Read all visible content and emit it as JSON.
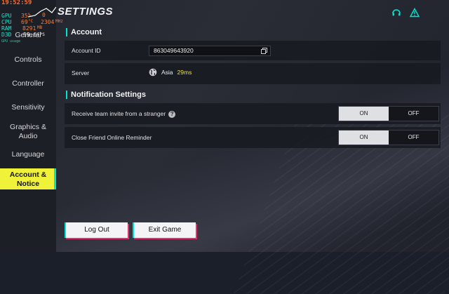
{
  "overlay": {
    "clock": "19:52:59",
    "rows": [
      {
        "label": "GPU",
        "value": "35",
        "unit": "%"
      },
      {
        "label": "CPU",
        "value": "69",
        "unit": "°C"
      },
      {
        "label": "RAM",
        "value": "8291",
        "unit": "MB"
      },
      {
        "label": "D3D",
        "value": "59.6",
        "unit": "FPS"
      }
    ],
    "fps_extra": "0",
    "cpu_mhz": "2304",
    "cpu_mhz_unit": "MHz",
    "gpu_usage_label": "GPU usage"
  },
  "header": {
    "title": "SETTINGS",
    "icons": [
      "headset-icon",
      "warning-icon"
    ]
  },
  "sidebar": {
    "items": [
      {
        "label": "General"
      },
      {
        "label": "Controls"
      },
      {
        "label": "Controller"
      },
      {
        "label": "Sensitivity"
      },
      {
        "label": "Graphics &\nAudio"
      },
      {
        "label": "Language"
      },
      {
        "label": "Account &\nNotice",
        "active": true
      }
    ]
  },
  "account": {
    "section_title": "Account",
    "account_id_label": "Account ID",
    "account_id_value": "863049643920",
    "server_label": "Server",
    "server_region": "Asia",
    "server_ping": "29ms"
  },
  "notifications": {
    "section_title": "Notification Settings",
    "items": [
      {
        "label": "Receive team invite from a stranger",
        "on": "ON",
        "off": "OFF",
        "selected": "ON",
        "has_help": true
      },
      {
        "label": "Close Friend Online Reminder",
        "on": "ON",
        "off": "OFF",
        "selected": "ON",
        "has_help": false
      }
    ]
  },
  "buttons": {
    "logout": "Log Out",
    "exit": "Exit Game"
  },
  "colors": {
    "accent": "#00e5d0",
    "active_tab": "#f0f23a",
    "ping": "#e8e040",
    "button_shadow": "#e2306a"
  }
}
